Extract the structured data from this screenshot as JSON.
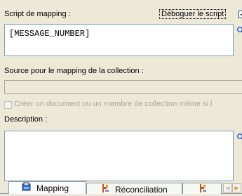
{
  "script": {
    "label": "Script de mapping :",
    "value": "[MESSAGE_NUMBER]",
    "debug_label": "Déboguer le script",
    "debug_checked": "✓",
    "zoom_glyph": "🔍"
  },
  "source": {
    "label": "Source pour le mapping de la collection :",
    "value": ""
  },
  "create_option": {
    "label": "Créer un document ou un membre de collection même si l"
  },
  "description": {
    "label": "Description :",
    "value": "",
    "zoom_glyph": "🔍"
  },
  "tabs": [
    {
      "label": "Mapping",
      "icon": "mapping-icon"
    },
    {
      "label": "Réconciliation",
      "icon": "reconciliation-icon"
    },
    {
      "label": "",
      "icon": "script-icon"
    }
  ],
  "tab_scroll": {
    "left": "◀",
    "right": "▶"
  }
}
